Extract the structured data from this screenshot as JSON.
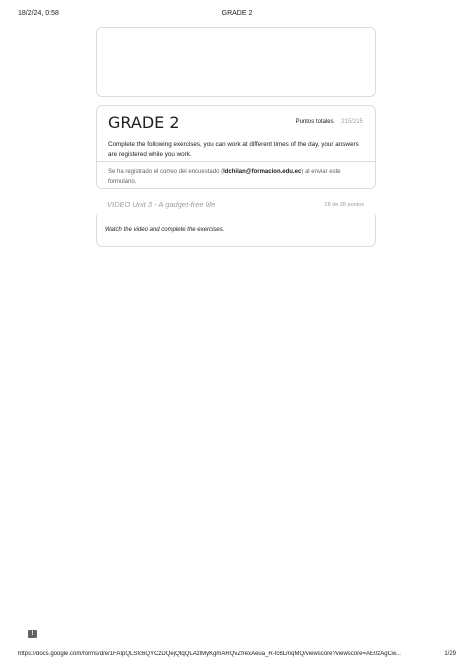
{
  "print_header": {
    "date": "18/2/24, 0:58",
    "title": "GRADE 2"
  },
  "form": {
    "title": "GRADE 2",
    "points_label": "Puntos totales",
    "points_value": "215/215",
    "description": "Complete the following exercises, you can work at different times of the day, your answers are registered while you work.",
    "email_prefix": "Se ha registrado el correo del encuestado (",
    "email": "ldchilan@formacion.edu.ec",
    "email_suffix": ") al enviar este formulario."
  },
  "section": {
    "title": "VIDEO Unit 3 - A gadget-free life",
    "points": "28 de 28 puntos",
    "description": "Watch the video and complete the exercises."
  },
  "print_footer": {
    "url": "https://docs.google.com/forms/d/e/1FAIpQLSfc6QYCzDQejQtqQLAzlMyKgmARQvZfrexAeua_R-fc6LmqMQ/viewscore?viewscore=AE0zAgCw...",
    "page": "1/29"
  }
}
